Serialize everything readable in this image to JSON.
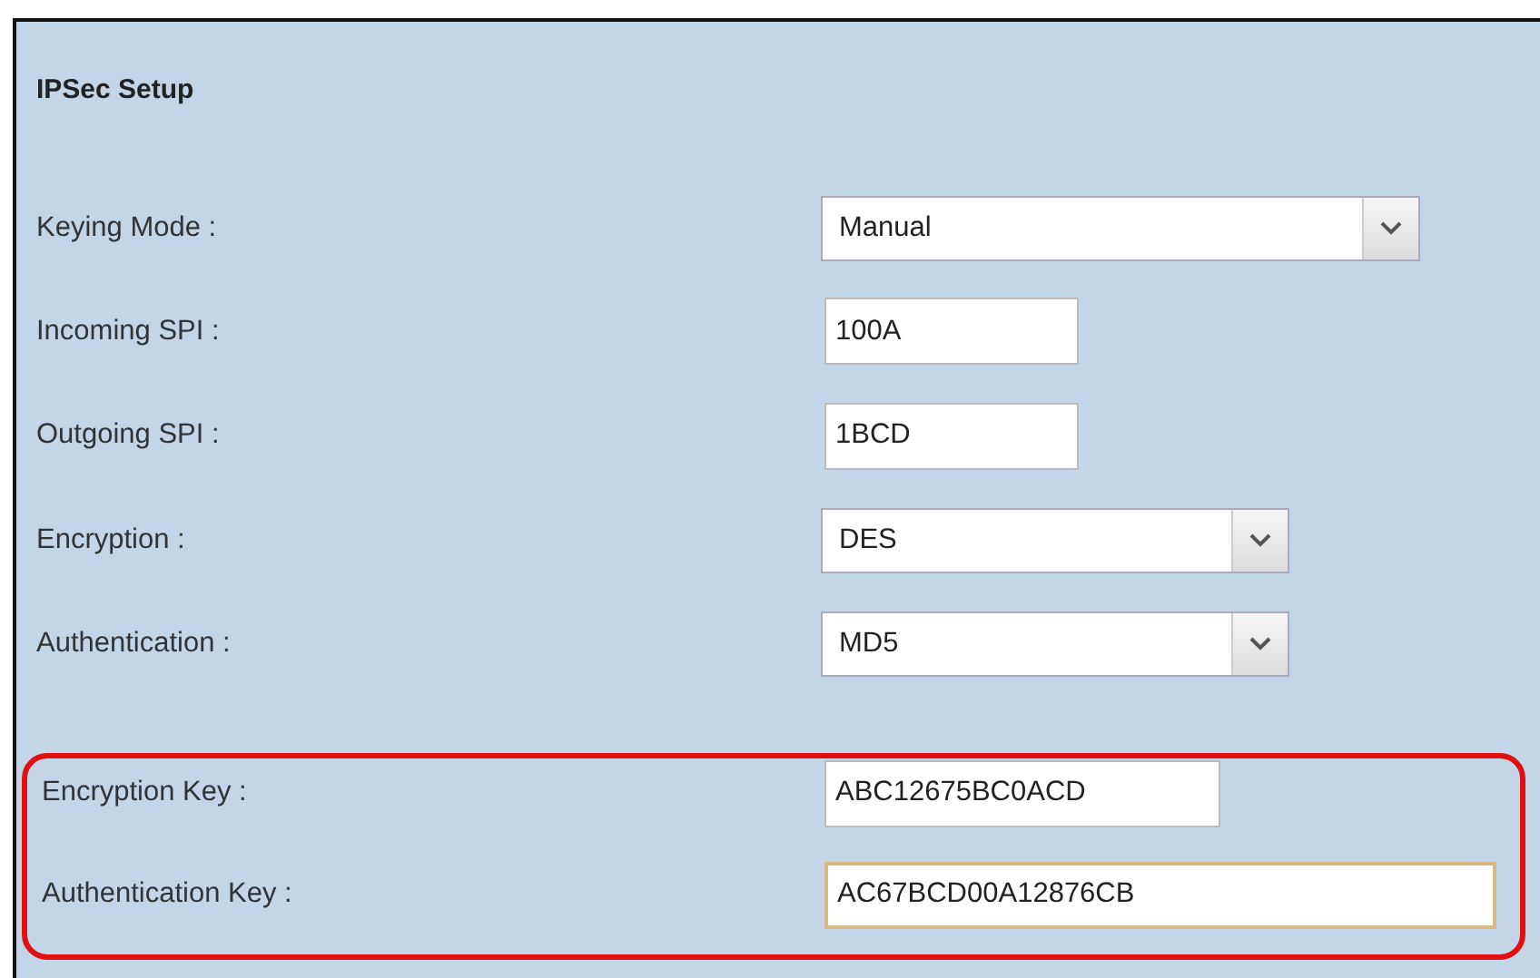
{
  "section": {
    "title": "IPSec Setup"
  },
  "fields": [
    {
      "label": "Keying Mode :",
      "kind": "select",
      "value": "Manual",
      "highlighted": false,
      "focused": false
    },
    {
      "label": "Incoming SPI :",
      "kind": "text",
      "value": "100A",
      "highlighted": false,
      "focused": false
    },
    {
      "label": "Outgoing SPI :",
      "kind": "text",
      "value": "1BCD",
      "highlighted": false,
      "focused": false
    },
    {
      "label": "Encryption :",
      "kind": "select",
      "value": "DES",
      "highlighted": false,
      "focused": false
    },
    {
      "label": "Authentication :",
      "kind": "select",
      "value": "MD5",
      "highlighted": false,
      "focused": false
    },
    {
      "label": "Encryption Key :",
      "kind": "text",
      "value": "ABC12675BC0ACD",
      "highlighted": true,
      "focused": false
    },
    {
      "label": "Authentication Key :",
      "kind": "text",
      "value": "AC67BCD00A12876CB",
      "highlighted": true,
      "focused": true
    }
  ]
}
